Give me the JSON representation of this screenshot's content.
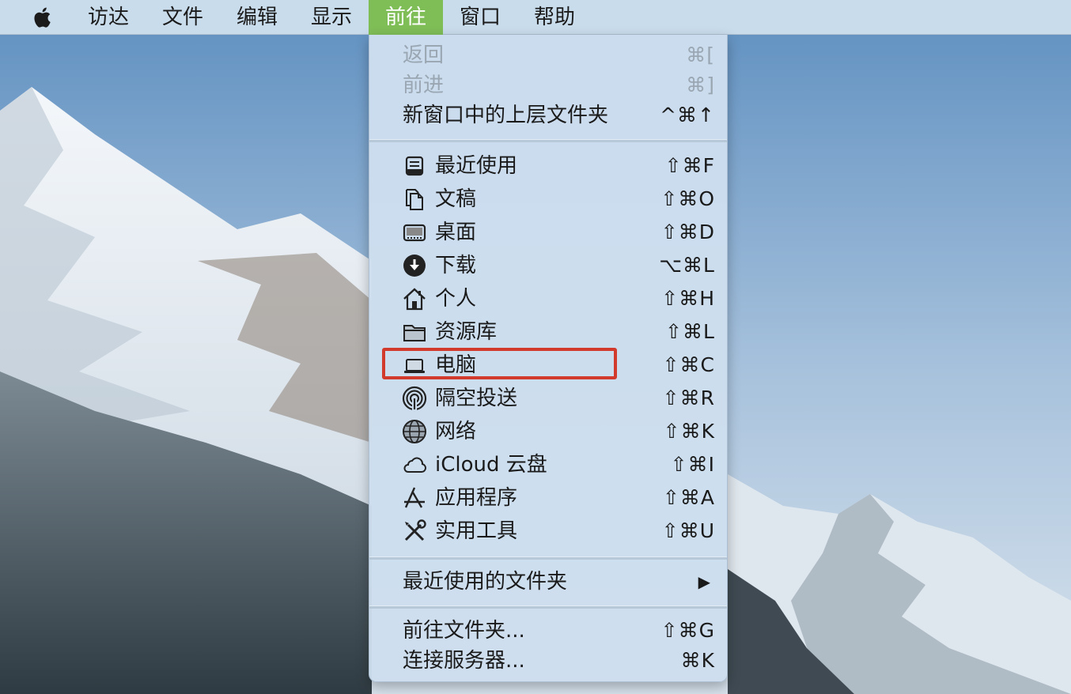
{
  "menubar": {
    "items": [
      {
        "label": "访达"
      },
      {
        "label": "文件"
      },
      {
        "label": "编辑"
      },
      {
        "label": "显示"
      },
      {
        "label": "前往"
      },
      {
        "label": "窗口"
      },
      {
        "label": "帮助"
      }
    ],
    "active_index": 4
  },
  "go_menu": {
    "back": {
      "label": "返回",
      "shortcut": "⌘[",
      "enabled": false
    },
    "forward": {
      "label": "前进",
      "shortcut": "⌘]",
      "enabled": false
    },
    "enclosing": {
      "label": "新窗口中的上层文件夹",
      "shortcut": "^⌘↑"
    },
    "places": [
      {
        "label": "最近使用",
        "shortcut": "⇧⌘F",
        "icon": "recents-icon"
      },
      {
        "label": "文稿",
        "shortcut": "⇧⌘O",
        "icon": "documents-icon"
      },
      {
        "label": "桌面",
        "shortcut": "⇧⌘D",
        "icon": "desktop-icon"
      },
      {
        "label": "下载",
        "shortcut": "⌥⌘L",
        "icon": "downloads-icon"
      },
      {
        "label": "个人",
        "shortcut": "⇧⌘H",
        "icon": "home-icon"
      },
      {
        "label": "资源库",
        "shortcut": "⇧⌘L",
        "icon": "folder-icon"
      },
      {
        "label": "电脑",
        "shortcut": "⇧⌘C",
        "icon": "computer-icon"
      },
      {
        "label": "隔空投送",
        "shortcut": "⇧⌘R",
        "icon": "airdrop-icon"
      },
      {
        "label": "网络",
        "shortcut": "⇧⌘K",
        "icon": "network-icon"
      },
      {
        "label": "iCloud 云盘",
        "shortcut": "⇧⌘I",
        "icon": "icloud-icon"
      },
      {
        "label": "应用程序",
        "shortcut": "⇧⌘A",
        "icon": "applications-icon"
      },
      {
        "label": "实用工具",
        "shortcut": "⇧⌘U",
        "icon": "utilities-icon"
      }
    ],
    "recent_folders": {
      "label": "最近使用的文件夹",
      "submenu_arrow": "▶"
    },
    "go_to_folder": {
      "label": "前往文件夹...",
      "shortcut": "⇧⌘G"
    },
    "connect_server": {
      "label": "连接服务器...",
      "shortcut": "⌘K"
    }
  },
  "colors": {
    "menubar_bg": "#c9dcec",
    "active_menu_bg": "#7fbd57",
    "menu_bg": "#cddeee",
    "highlight_border": "#d23a2c"
  }
}
